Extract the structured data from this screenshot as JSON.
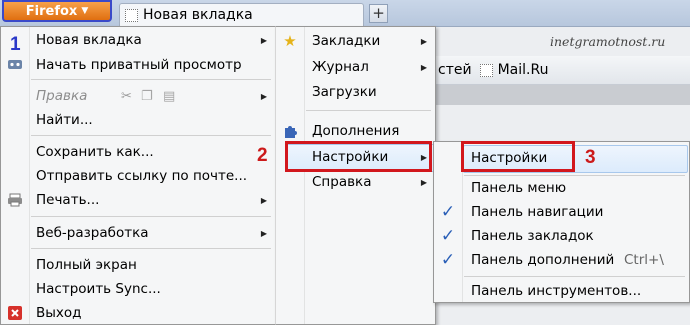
{
  "toolbar": {
    "firefox_label": "Firefox",
    "tab_title": "Новая вкладка",
    "new_tab_plus": "+"
  },
  "background": {
    "watermark": "inetgramotnost.ru",
    "bookmark_partial": "стей",
    "bookmark_mailru": "Mail.Ru"
  },
  "annotations": {
    "n1": "1",
    "n2": "2",
    "n3": "3"
  },
  "main_menu": {
    "new_tab": "Новая вкладка",
    "private": "Начать приватный просмотр",
    "edit": "Правка",
    "find": "Найти...",
    "save_as": "Сохранить как...",
    "send_link": "Отправить ссылку по почте...",
    "print": "Печать...",
    "web_dev": "Веб-разработка",
    "fullscreen": "Полный экран",
    "sync": "Настроить Sync...",
    "exit": "Выход"
  },
  "right_menu": {
    "bookmarks": "Закладки",
    "history": "Журнал",
    "downloads": "Загрузки",
    "addons": "Дополнения",
    "settings": "Настройки",
    "help": "Справка"
  },
  "settings_menu": {
    "settings": "Настройки",
    "menu_bar": "Панель меню",
    "nav_bar": "Панель навигации",
    "bookmarks_bar": "Панель закладок",
    "addon_bar": "Панель дополнений",
    "addon_shortcut": "Ctrl+\\",
    "customize": "Панель инструментов..."
  },
  "checks": {
    "nav_bar": true,
    "bookmarks_bar": true,
    "addon_bar": true
  }
}
